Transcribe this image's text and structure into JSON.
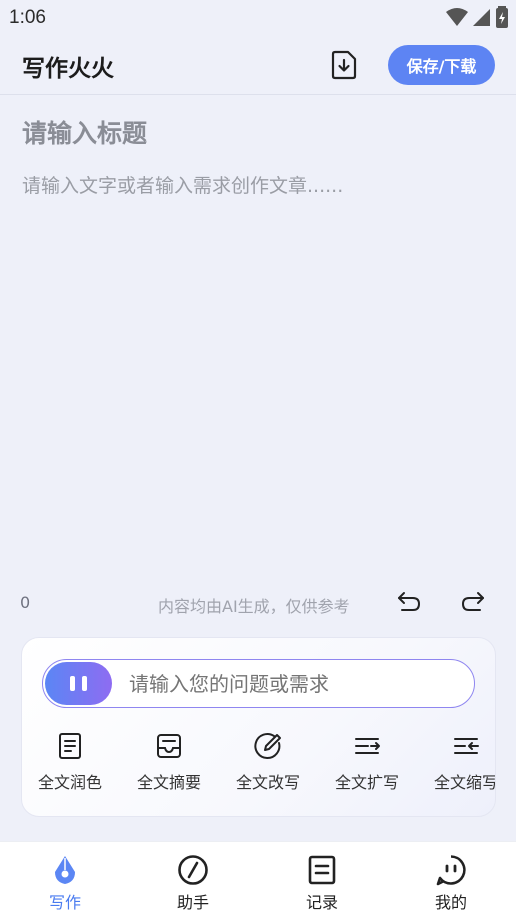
{
  "status_bar": {
    "time": "1:06"
  },
  "header": {
    "title": "写作火火",
    "save_label": "保存/下载"
  },
  "editor": {
    "title_placeholder": "请输入标题",
    "body_placeholder": "请输入文字或者输入需求创作文章......",
    "word_count": "0",
    "disclaimer": "内容均由AI生成，仅供参考"
  },
  "assistant": {
    "question_placeholder": "请输入您的问题或需求",
    "tools": [
      {
        "label": "全文润色",
        "icon": "document-lines-icon"
      },
      {
        "label": "全文摘要",
        "icon": "inbox-tray-icon"
      },
      {
        "label": "全文改写",
        "icon": "pencil-circle-icon"
      },
      {
        "label": "全文扩写",
        "icon": "expand-lines-icon"
      },
      {
        "label": "全文缩写",
        "icon": "collapse-lines-icon"
      }
    ]
  },
  "bottom_nav": [
    {
      "label": "写作",
      "icon": "pen-nib-icon",
      "active": true
    },
    {
      "label": "助手",
      "icon": "compass-icon",
      "active": false
    },
    {
      "label": "记录",
      "icon": "record-list-icon",
      "active": false
    },
    {
      "label": "我的",
      "icon": "profile-face-icon",
      "active": false
    }
  ],
  "colors": {
    "accent": "#5d84f3",
    "nav_active": "#4a7bf0",
    "gradient_end": "#8e6cf2"
  }
}
